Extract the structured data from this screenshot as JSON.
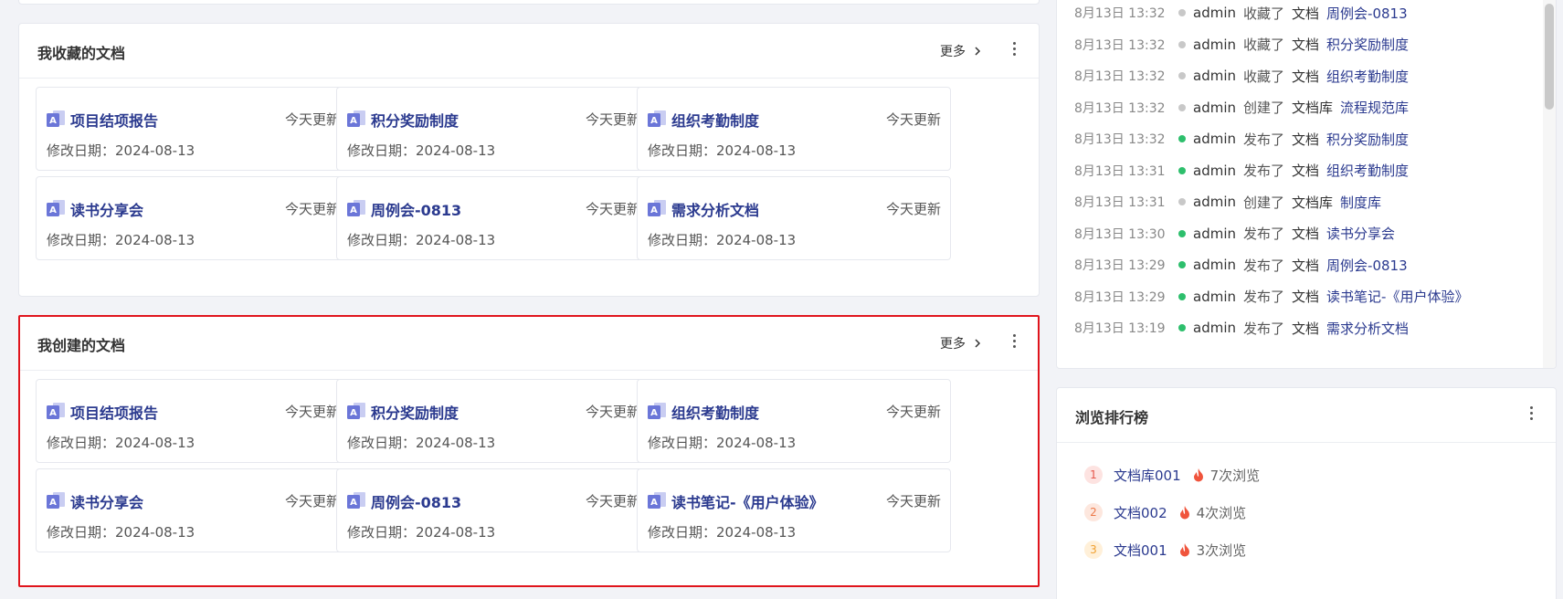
{
  "favorites": {
    "title": "我收藏的文档",
    "more": "更多",
    "cards": [
      {
        "title": "项目结项报告",
        "badge": "今天更新",
        "date": "修改日期：2024-08-13"
      },
      {
        "title": "积分奖励制度",
        "badge": "今天更新",
        "date": "修改日期：2024-08-13"
      },
      {
        "title": "组织考勤制度",
        "badge": "今天更新",
        "date": "修改日期：2024-08-13"
      },
      {
        "title": "读书分享会",
        "badge": "今天更新",
        "date": "修改日期：2024-08-13"
      },
      {
        "title": "周例会-0813",
        "badge": "今天更新",
        "date": "修改日期：2024-08-13"
      },
      {
        "title": "需求分析文档",
        "badge": "今天更新",
        "date": "修改日期：2024-08-13"
      }
    ]
  },
  "created": {
    "title": "我创建的文档",
    "more": "更多",
    "cards": [
      {
        "title": "项目结项报告",
        "badge": "今天更新",
        "date": "修改日期：2024-08-13"
      },
      {
        "title": "积分奖励制度",
        "badge": "今天更新",
        "date": "修改日期：2024-08-13"
      },
      {
        "title": "组织考勤制度",
        "badge": "今天更新",
        "date": "修改日期：2024-08-13"
      },
      {
        "title": "读书分享会",
        "badge": "今天更新",
        "date": "修改日期：2024-08-13"
      },
      {
        "title": "周例会-0813",
        "badge": "今天更新",
        "date": "修改日期：2024-08-13"
      },
      {
        "title": "读书笔记-《用户体验》",
        "badge": "今天更新",
        "date": "修改日期：2024-08-13"
      }
    ]
  },
  "activity": [
    {
      "time": "8月13日 13:32",
      "dot": "#c8c8c8",
      "user": "admin",
      "action": "收藏了",
      "type": "文档",
      "target": "周例会-0813"
    },
    {
      "time": "8月13日 13:32",
      "dot": "#c8c8c8",
      "user": "admin",
      "action": "收藏了",
      "type": "文档",
      "target": "积分奖励制度"
    },
    {
      "time": "8月13日 13:32",
      "dot": "#c8c8c8",
      "user": "admin",
      "action": "收藏了",
      "type": "文档",
      "target": "组织考勤制度"
    },
    {
      "time": "8月13日 13:32",
      "dot": "#c8c8c8",
      "user": "admin",
      "action": "创建了",
      "type": "文档库",
      "target": "流程规范库"
    },
    {
      "time": "8月13日 13:32",
      "dot": "#2dbf6c",
      "user": "admin",
      "action": "发布了",
      "type": "文档",
      "target": "积分奖励制度"
    },
    {
      "time": "8月13日 13:31",
      "dot": "#2dbf6c",
      "user": "admin",
      "action": "发布了",
      "type": "文档",
      "target": "组织考勤制度"
    },
    {
      "time": "8月13日 13:31",
      "dot": "#c8c8c8",
      "user": "admin",
      "action": "创建了",
      "type": "文档库",
      "target": "制度库"
    },
    {
      "time": "8月13日 13:30",
      "dot": "#2dbf6c",
      "user": "admin",
      "action": "发布了",
      "type": "文档",
      "target": "读书分享会"
    },
    {
      "time": "8月13日 13:29",
      "dot": "#2dbf6c",
      "user": "admin",
      "action": "发布了",
      "type": "文档",
      "target": "周例会-0813"
    },
    {
      "time": "8月13日 13:29",
      "dot": "#2dbf6c",
      "user": "admin",
      "action": "发布了",
      "type": "文档",
      "target": "读书笔记-《用户体验》"
    },
    {
      "time": "8月13日 13:19",
      "dot": "#2dbf6c",
      "user": "admin",
      "action": "发布了",
      "type": "文档",
      "target": "需求分析文档"
    }
  ],
  "ranking": {
    "title": "浏览排行榜",
    "items": [
      {
        "rank": "1",
        "name": "文档库001",
        "views": "7次浏览",
        "bg": "#fde3e1",
        "fg": "#e5574b"
      },
      {
        "rank": "2",
        "name": "文档002",
        "views": "4次浏览",
        "bg": "#fde7de",
        "fg": "#ec7a4a"
      },
      {
        "rank": "3",
        "name": "文档001",
        "views": "3次浏览",
        "bg": "#fff0d9",
        "fg": "#f0a030"
      }
    ]
  },
  "colors": {
    "accent": "#2b3a8f",
    "highlight": "#e0141c",
    "fire": "#f0543c"
  }
}
